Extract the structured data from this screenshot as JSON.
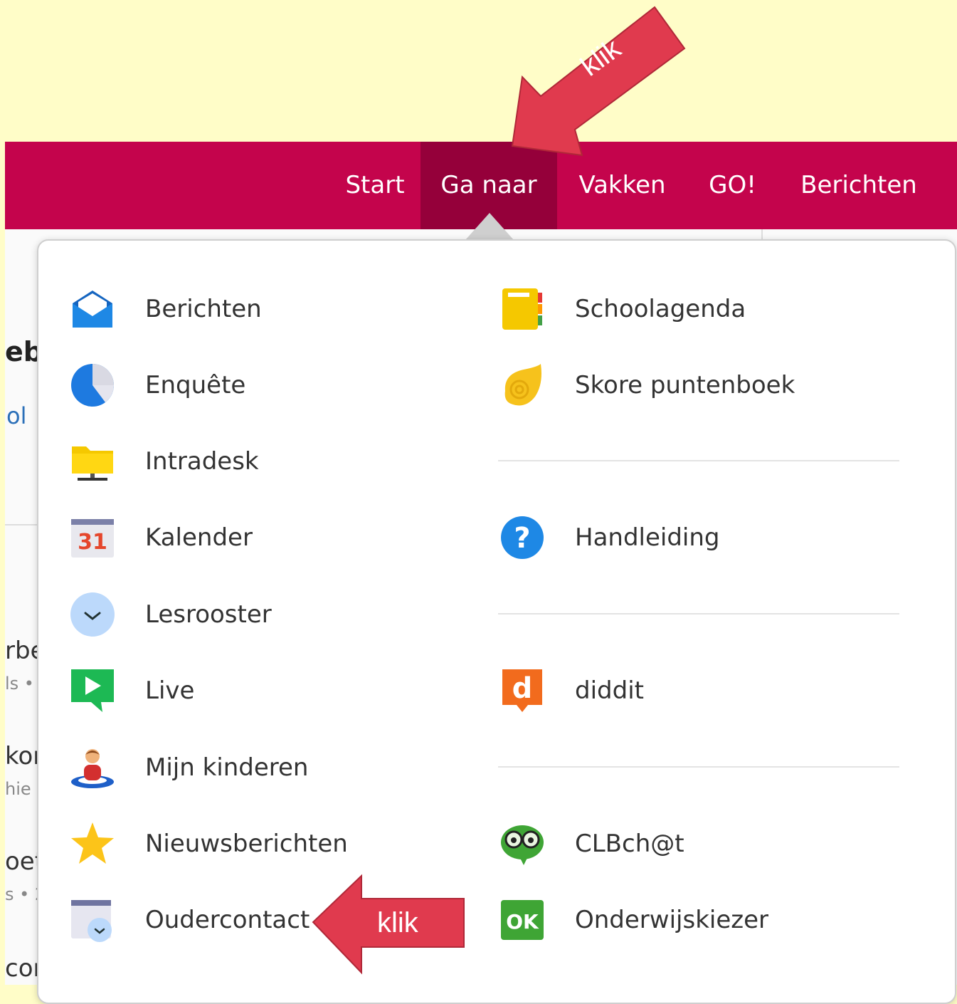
{
  "nav": {
    "items": [
      "Start",
      "Ga naar",
      "Vakken",
      "GO!",
      "Berichten"
    ],
    "active": "Ga naar",
    "bg_color": "#c4044c",
    "active_color": "#95003a"
  },
  "background_fragments": [
    "eb",
    "ol",
    "rbe",
    "ls •",
    "kor",
    "hie",
    "oet",
    "s • 2",
    "cor"
  ],
  "menu": {
    "left": [
      {
        "label": "Berichten",
        "icon": "envelope-icon"
      },
      {
        "label": "Enquête",
        "icon": "pie-chart-icon"
      },
      {
        "label": "Intradesk",
        "icon": "folder-icon"
      },
      {
        "label": "Kalender",
        "icon": "calendar-icon",
        "icon_text": "31"
      },
      {
        "label": "Lesrooster",
        "icon": "clock-icon"
      },
      {
        "label": "Live",
        "icon": "play-chat-icon"
      },
      {
        "label": "Mijn kinderen",
        "icon": "child-icon"
      },
      {
        "label": "Nieuwsberichten",
        "icon": "star-icon"
      },
      {
        "label": "Oudercontact",
        "icon": "calendar-clock-icon"
      }
    ],
    "right": [
      {
        "label": "Schoolagenda",
        "icon": "notebook-icon"
      },
      {
        "label": "Skore puntenboek",
        "icon": "shell-icon"
      },
      {
        "label": "Handleiding",
        "icon": "question-icon"
      },
      {
        "label": "diddit",
        "icon": "diddit-icon",
        "icon_text": "d"
      },
      {
        "label": "CLBch@t",
        "icon": "owl-chat-icon"
      },
      {
        "label": "Onderwijskiezer",
        "icon": "ok-icon",
        "icon_text": "OK"
      }
    ]
  },
  "annotations": {
    "top_arrow": "klik",
    "bottom_arrow": "klik",
    "arrow_color": "#e03a4e"
  }
}
